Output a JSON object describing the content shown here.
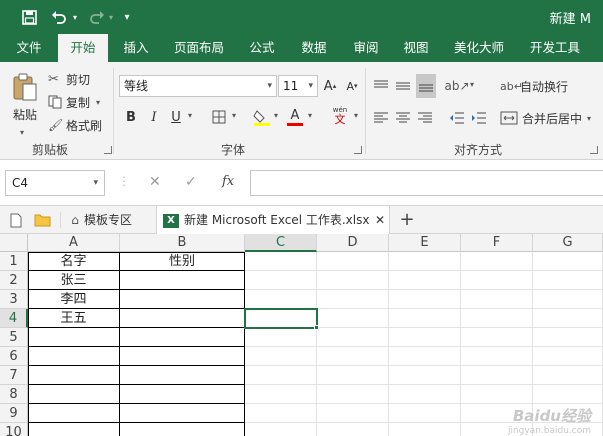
{
  "title_bar": {
    "title": "新建 M"
  },
  "ribbon_tabs": [
    "文件",
    "开始",
    "插入",
    "页面布局",
    "公式",
    "数据",
    "审阅",
    "视图",
    "美化大师",
    "开发工具"
  ],
  "active_tab": "开始",
  "clipboard": {
    "paste": "粘贴",
    "cut": "剪切",
    "copy": "复制",
    "format_painter": "格式刷",
    "group_label": "剪贴板"
  },
  "font": {
    "name": "等线",
    "size": "11",
    "bold": "B",
    "italic": "I",
    "underline": "U",
    "group_label": "字体",
    "phonetic": "wén"
  },
  "alignment": {
    "wrap_text": "自动换行",
    "merge_center": "合并后居中",
    "group_label": "对齐方式"
  },
  "formula_bar": {
    "name_box": "C4",
    "cancel": "✕",
    "enter": "✓",
    "fx": "fx",
    "formula": ""
  },
  "file_tabs": {
    "template_tab": "模板专区",
    "file_tab": "新建 Microsoft Excel 工作表.xlsx",
    "close": "✕",
    "add": "+"
  },
  "sheet": {
    "columns": [
      "A",
      "B",
      "C",
      "D",
      "E",
      "F",
      "G"
    ],
    "rows": [
      "1",
      "2",
      "3",
      "4",
      "5",
      "6",
      "7",
      "8",
      "9",
      "10"
    ],
    "cells": {
      "A1": "名字",
      "B1": "性别",
      "A2": "张三",
      "A3": "李四",
      "A4": "王五"
    },
    "selected_cell": "C4"
  },
  "watermark": {
    "text": "Baidu经验",
    "sub": "jingyan.baidu.com"
  }
}
